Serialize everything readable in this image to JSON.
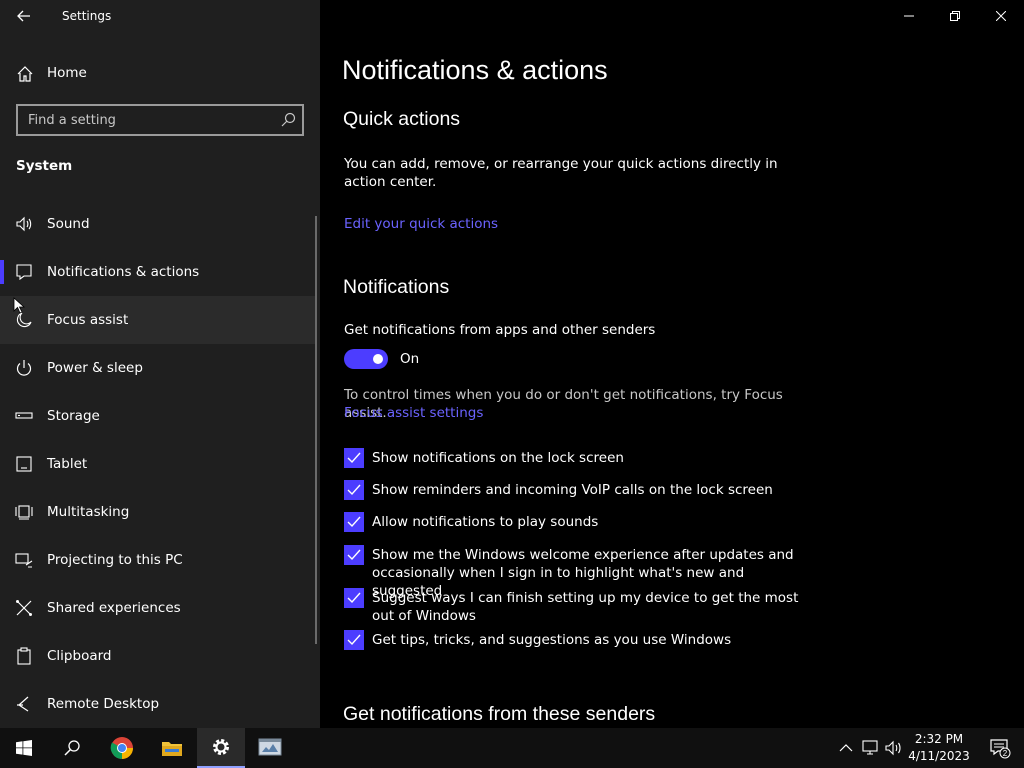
{
  "window": {
    "title": "Settings"
  },
  "sidebar": {
    "home_label": "Home",
    "search_placeholder": "Find a setting",
    "section_title": "System",
    "items": [
      {
        "label": "Sound",
        "icon": "speaker-icon"
      },
      {
        "label": "Notifications & actions",
        "icon": "message-icon",
        "selected": true
      },
      {
        "label": "Focus assist",
        "icon": "moon-icon",
        "hover": true
      },
      {
        "label": "Power & sleep",
        "icon": "power-icon"
      },
      {
        "label": "Storage",
        "icon": "storage-icon"
      },
      {
        "label": "Tablet",
        "icon": "tablet-icon"
      },
      {
        "label": "Multitasking",
        "icon": "multitasking-icon"
      },
      {
        "label": "Projecting to this PC",
        "icon": "projecting-icon"
      },
      {
        "label": "Shared experiences",
        "icon": "shared-icon"
      },
      {
        "label": "Clipboard",
        "icon": "clipboard-icon"
      },
      {
        "label": "Remote Desktop",
        "icon": "remote-desktop-icon"
      }
    ]
  },
  "main": {
    "page_title": "Notifications & actions",
    "quick_actions": {
      "heading": "Quick actions",
      "description": "You can add, remove, or rearrange your quick actions directly in action center.",
      "link": "Edit your quick actions"
    },
    "notifications": {
      "heading": "Notifications",
      "toggle_label": "Get notifications from apps and other senders",
      "toggle_state": "On",
      "focus_text": "To control times when you do or don't get notifications, try Focus assist.",
      "focus_link": "Focus assist settings",
      "checkboxes": [
        {
          "label": "Show notifications on the lock screen",
          "checked": true
        },
        {
          "label": "Show reminders and incoming VoIP calls on the lock screen",
          "checked": true
        },
        {
          "label": "Allow notifications to play sounds",
          "checked": true
        },
        {
          "label": "Show me the Windows welcome experience after updates and occasionally when I sign in to highlight what's new and suggested",
          "checked": true
        },
        {
          "label": "Suggest ways I can finish setting up my device to get the most out of Windows",
          "checked": true
        },
        {
          "label": "Get tips, tricks, and suggestions as you use Windows",
          "checked": true
        }
      ]
    },
    "senders_heading": "Get notifications from these senders"
  },
  "taskbar": {
    "time": "2:32 PM",
    "date": "4/11/2023",
    "notification_count": "2"
  },
  "colors": {
    "accent": "#4c3dff",
    "link": "#6b63ff",
    "sidebar_bg": "#1f1f1f",
    "main_bg": "#000000"
  }
}
